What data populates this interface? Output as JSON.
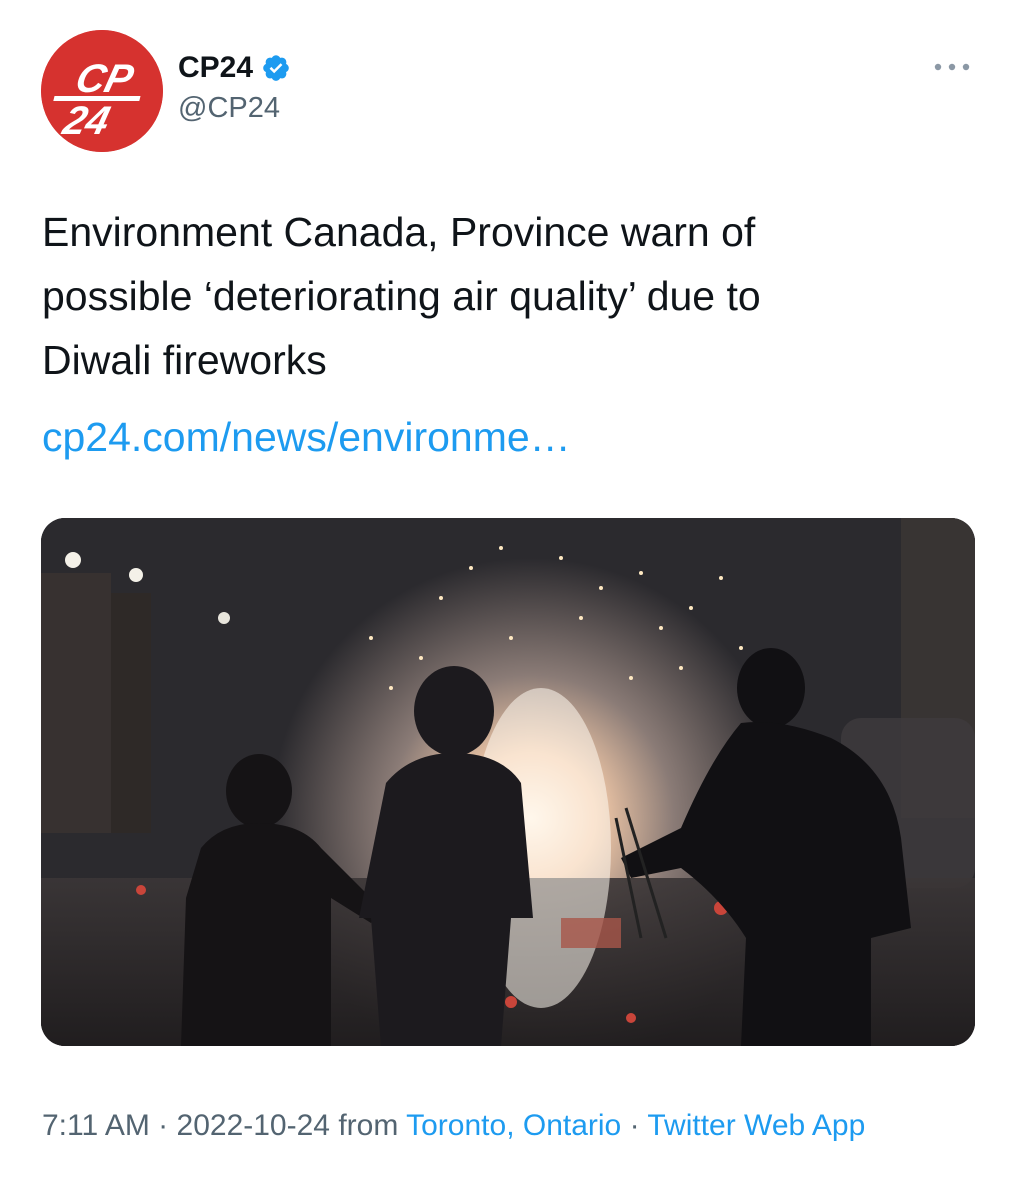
{
  "author": {
    "display_name": "CP24",
    "handle": "@CP24",
    "avatar_text_top": "CP",
    "avatar_text_bottom": "24",
    "verified_icon": "verified-badge-icon",
    "more_icon": "more-options-icon"
  },
  "tweet": {
    "text_lines": [
      "Environment Canada, Province warn of",
      "possible ‘deteriorating air quality’ due to",
      "Diwali fireworks"
    ],
    "link": "cp24.com/news/environme…"
  },
  "meta": {
    "time": "7:11 AM",
    "separator": " · ",
    "date": "2022-10-24",
    "from_label": " from ",
    "location": "Toronto, Ontario",
    "source": "Twitter Web App"
  },
  "colors": {
    "brand_red": "#d6322f",
    "link_blue": "#1d9bf0",
    "secondary_text": "#536471"
  }
}
